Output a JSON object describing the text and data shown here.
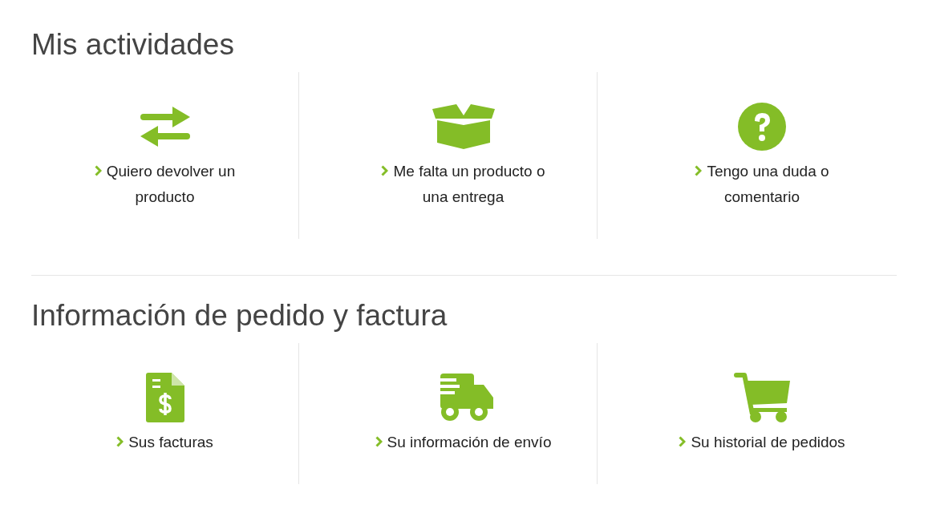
{
  "sections": [
    {
      "title": "Mis actividades",
      "items": [
        {
          "kind": "exchange",
          "label": "Quiero devolver un producto"
        },
        {
          "kind": "box",
          "label": "Me falta un producto o una entrega"
        },
        {
          "kind": "question",
          "label": "Tengo una duda o comentario"
        }
      ]
    },
    {
      "title": "Información de pedido y factura",
      "items": [
        {
          "kind": "invoice",
          "label": "Sus facturas"
        },
        {
          "kind": "truck",
          "label": "Su información de envío"
        },
        {
          "kind": "cart",
          "label": "Su historial de pedidos"
        }
      ]
    }
  ]
}
